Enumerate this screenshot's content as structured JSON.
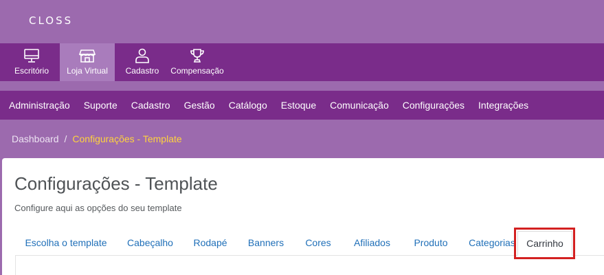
{
  "logo": {
    "text": "CLOSS"
  },
  "modules": [
    {
      "label": "Escritório",
      "icon": "monitor-icon",
      "active": false
    },
    {
      "label": "Loja Virtual",
      "icon": "store-icon",
      "active": true
    },
    {
      "label": "Cadastro",
      "icon": "user-icon",
      "active": false
    },
    {
      "label": "Compensação",
      "icon": "trophy-icon",
      "active": false
    }
  ],
  "nav": {
    "items": [
      "Administração",
      "Suporte",
      "Cadastro",
      "Gestão",
      "Catálogo",
      "Estoque",
      "Comunicação",
      "Configurações",
      "Integrações"
    ]
  },
  "breadcrumb": {
    "home": "Dashboard",
    "separator": "/",
    "current": "Configurações - Template"
  },
  "page": {
    "title": "Configurações - Template",
    "subtitle": "Configure aqui as opções do seu template"
  },
  "tabs": [
    {
      "label": "Escolha o template",
      "active": false
    },
    {
      "label": "Cabeçalho",
      "active": false
    },
    {
      "label": "Rodapé",
      "active": false
    },
    {
      "label": "Banners",
      "active": false
    },
    {
      "label": "Cores",
      "active": false
    },
    {
      "label": "Afiliados",
      "active": false
    },
    {
      "label": "Produto",
      "active": false
    },
    {
      "label": "Categorias",
      "active": false
    },
    {
      "label": "Carrinho",
      "active": true
    }
  ],
  "colors": {
    "header_bg": "#9c6aae",
    "nav_bg": "#7a2c8a",
    "active_module_bg": "#a97cbc",
    "breadcrumb_current": "#ffd33d",
    "tab_link": "#1f6fb8",
    "highlight_border": "#d32020"
  }
}
